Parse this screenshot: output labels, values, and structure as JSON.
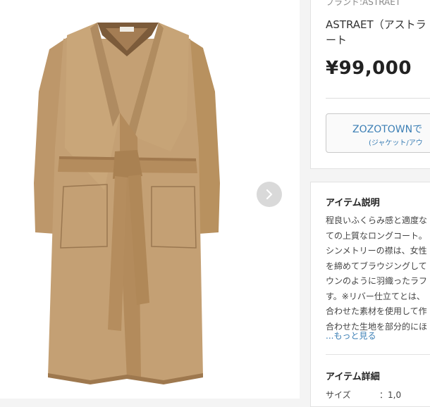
{
  "product": {
    "brand_line": "ブランド:ASTRAET",
    "name_line1": "ASTRAET（アストラ",
    "name_line2": "ート",
    "price": "¥99,000"
  },
  "purchase": {
    "button_main": "ZOZOTOWNで",
    "button_sub": "(ジャケット/アウ"
  },
  "description": {
    "title": "アイテム説明",
    "lines": [
      "程良いふくらみ感と適度な",
      "ての上質なロングコート。",
      "シンメトリーの襟は、女性",
      "を締めてブラウジングして",
      "ウンのように羽織ったラフ",
      "す。※リバー仕立てとは、",
      "合わせた素材を使用して作",
      "合わせた生地を部分的にほ"
    ],
    "more": "...もっと見る"
  },
  "details": {
    "title": "アイテム詳細",
    "size_label": "サイズ",
    "size_value": "：1,0"
  },
  "gallery": {
    "next_icon": "chevron-right-icon",
    "colors": {
      "coat": "#c09a6e",
      "coat_dark": "#8e6b46",
      "arrow_bg": "#d9d9d9"
    }
  }
}
